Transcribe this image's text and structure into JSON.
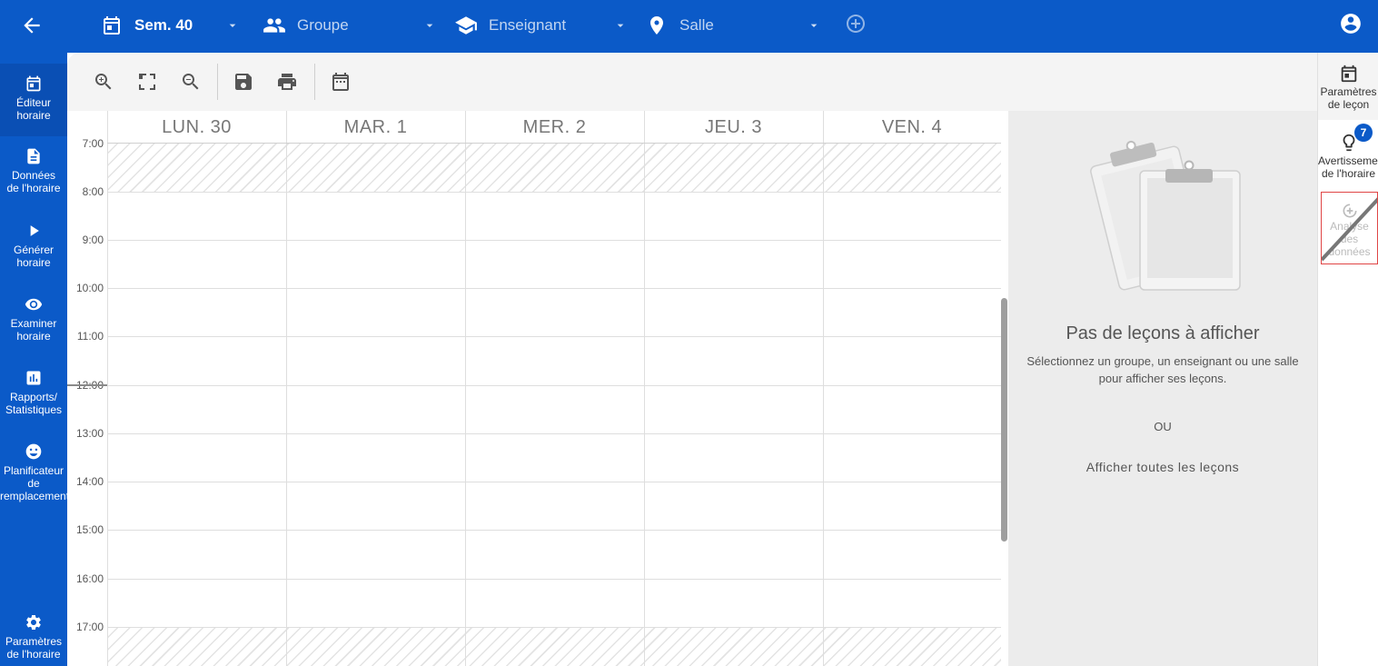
{
  "topbar": {
    "week_label": "Sem. 40",
    "group_placeholder": "Groupe",
    "teacher_placeholder": "Enseignant",
    "room_placeholder": "Salle"
  },
  "sidebar": {
    "items": [
      {
        "label": "Éditeur\nhoraire",
        "icon": "calendar-today-icon"
      },
      {
        "label": "Données\nde l'horaire",
        "icon": "document-icon"
      },
      {
        "label": "Générer\nhoraire",
        "icon": "play-icon"
      },
      {
        "label": "Examiner\nhoraire",
        "icon": "eye-icon"
      },
      {
        "label": "Rapports/\nStatistiques",
        "icon": "chart-icon"
      },
      {
        "label": "Planificateur\nde\nremplacement",
        "icon": "face-icon"
      },
      {
        "label": "Paramètres\nde l'horaire",
        "icon": "gear-icon"
      }
    ]
  },
  "calendar": {
    "days": [
      "LUN. 30",
      "MAR. 1",
      "MER. 2",
      "JEU. 3",
      "VEN. 4"
    ],
    "hours": [
      "7:00",
      "8:00",
      "9:00",
      "10:00",
      "11:00",
      "12:00",
      "13:00",
      "14:00",
      "15:00",
      "16:00",
      "17:00"
    ]
  },
  "lessons_panel": {
    "title": "Pas de leçons à afficher",
    "description": "Sélectionnez un groupe, un enseignant ou une salle pour afficher ses leçons.",
    "or": "OU",
    "show_all": "Afficher toutes les leçons"
  },
  "rightbar": {
    "lesson_params": "Paramètres\nde leçon",
    "warnings": "Avertissements\nde l'horaire",
    "warnings_count": "7",
    "data_analysis": "Analyse\ndes données"
  },
  "colors": {
    "primary": "#0b5ac8",
    "toolbar_bg": "#f4f4f4",
    "panel_bg": "#ececec",
    "disabled_border": "#e04545"
  }
}
